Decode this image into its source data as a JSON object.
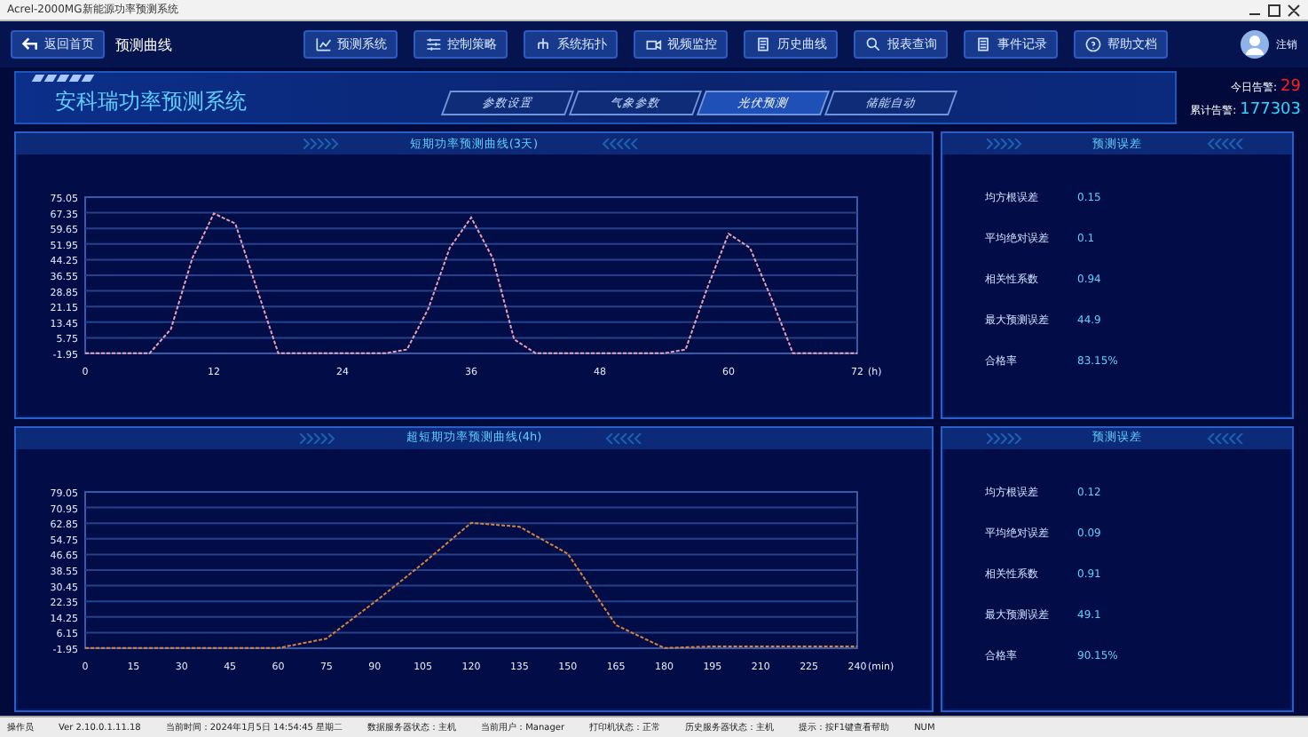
{
  "window": {
    "title": "Acrel-2000MG新能源功率预测系统"
  },
  "nav": {
    "back": "返回首页",
    "page_title": "预测曲线",
    "items": [
      {
        "label": "预测系统"
      },
      {
        "label": "控制策略"
      },
      {
        "label": "系统拓扑"
      },
      {
        "label": "视频监控"
      },
      {
        "label": "历史曲线"
      },
      {
        "label": "报表查询"
      },
      {
        "label": "事件记录"
      },
      {
        "label": "帮助文档"
      }
    ],
    "user": "注销"
  },
  "header": {
    "system_title": "安科瑞功率预测系统",
    "tabs": [
      {
        "label": "参数设置",
        "selected": false
      },
      {
        "label": "气象参数",
        "selected": false
      },
      {
        "label": "光伏预测",
        "selected": true
      },
      {
        "label": "储能自动",
        "selected": false
      }
    ],
    "alarms": [
      {
        "label": "今日告警:",
        "value": "29",
        "color": "#ff2020"
      },
      {
        "label": "累计告警:",
        "value": "177303",
        "color": "#2fd6ff"
      }
    ]
  },
  "charts": [
    {
      "title": "短期功率预测曲线(3天)",
      "unit": "(h)",
      "chart_data": {
        "type": "line",
        "grid": true,
        "x": [
          0,
          2,
          4,
          6,
          8,
          10,
          12,
          14,
          16,
          18,
          20,
          22,
          24,
          26,
          28,
          30,
          32,
          34,
          36,
          38,
          40,
          42,
          44,
          46,
          48,
          50,
          52,
          54,
          56,
          58,
          60,
          62,
          64,
          66,
          68,
          70,
          72
        ],
        "series": [
          {
            "color": "#e7a1b4",
            "line_style": "dashed",
            "values": [
              -1.9,
              -1.9,
              -1.9,
              -1.9,
              10,
              45,
              67,
              62,
              30,
              -1.9,
              -1.9,
              -1.9,
              -1.9,
              -1.9,
              -1.9,
              0,
              20,
              50,
              65,
              45,
              5,
              -1.9,
              -1.9,
              -1.9,
              -1.9,
              -1.9,
              -1.9,
              -1.9,
              0,
              30,
              57,
              50,
              25,
              -1.9,
              -1.9,
              -1.9,
              -1.9
            ]
          }
        ],
        "xlim": [
          0,
          72
        ],
        "ylim": [
          -1.95,
          75.05
        ],
        "xticks": [
          0,
          12,
          24,
          36,
          48,
          60,
          72
        ],
        "yticks": [
          -1.95,
          5.75,
          13.45,
          21.15,
          28.85,
          36.55,
          44.25,
          51.95,
          59.65,
          67.35,
          75.05
        ]
      }
    },
    {
      "title": "超短期功率预测曲线(4h)",
      "unit": "(min)",
      "chart_data": {
        "type": "line",
        "grid": true,
        "x": [
          0,
          15,
          30,
          45,
          60,
          75,
          90,
          105,
          120,
          135,
          150,
          165,
          180,
          195,
          210,
          225,
          240
        ],
        "series": [
          {
            "color": "#d4843e",
            "line_style": "dashed",
            "values": [
              -1.9,
              -1.9,
              -1.9,
              -1.9,
              -1.9,
              3,
              22,
              42,
              63,
              61,
              47,
              10,
              -1.9,
              -1,
              -1,
              -1,
              -1
            ]
          }
        ],
        "xlim": [
          0,
          240
        ],
        "ylim": [
          -1.95,
          79.05
        ],
        "xticks": [
          0,
          15,
          30,
          45,
          60,
          75,
          90,
          105,
          120,
          135,
          150,
          165,
          180,
          195,
          210,
          225,
          240
        ],
        "yticks": [
          -1.95,
          6.15,
          14.25,
          22.35,
          30.45,
          38.55,
          46.65,
          54.75,
          62.85,
          70.95,
          79.05
        ]
      }
    }
  ],
  "error_panels": [
    {
      "title": "预测误差",
      "rows": [
        {
          "label": "均方根误差",
          "value": "0.15"
        },
        {
          "label": "平均绝对误差",
          "value": "0.1"
        },
        {
          "label": "相关性系数",
          "value": "0.94"
        },
        {
          "label": "最大预测误差",
          "value": "44.9"
        },
        {
          "label": "合格率",
          "value": "83.15%"
        }
      ]
    },
    {
      "title": "预测误差",
      "rows": [
        {
          "label": "均方根误差",
          "value": "0.12"
        },
        {
          "label": "平均绝对误差",
          "value": "0.09"
        },
        {
          "label": "相关性系数",
          "value": "0.91"
        },
        {
          "label": "最大预测误差",
          "value": "49.1"
        },
        {
          "label": "合格率",
          "value": "90.15%"
        }
      ]
    }
  ],
  "status_bar": [
    "操作员",
    "Ver 2.10.0.1.11.18",
    "当前时间：2024年1月5日 14:54:45 星期二",
    "数据服务器状态：主机",
    "当前用户：Manager",
    "打印机状态：正常",
    "历史服务器状态：主机",
    "提示：按F1键查看帮助",
    "NUM"
  ]
}
